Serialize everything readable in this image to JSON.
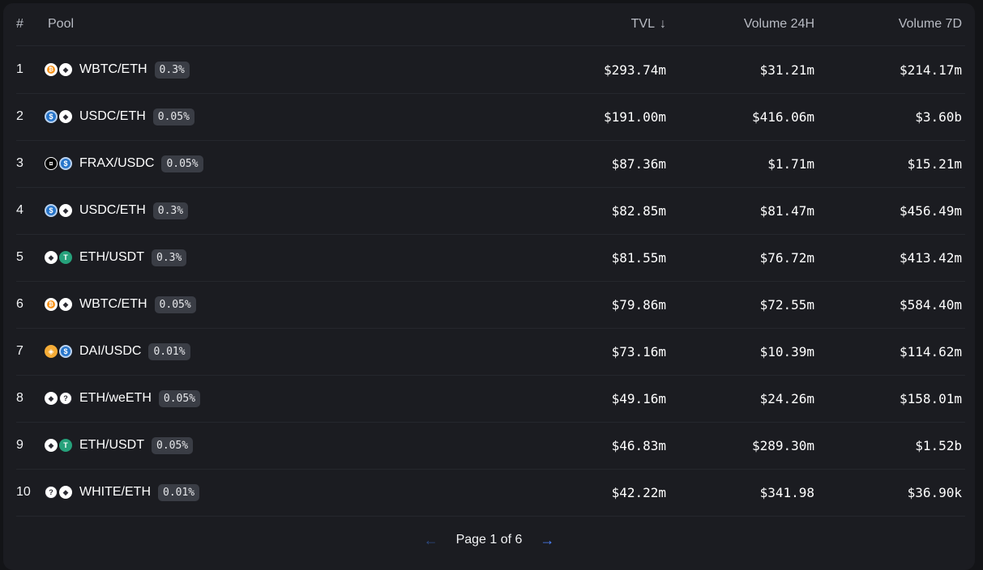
{
  "table": {
    "headers": {
      "index": "#",
      "pool": "Pool",
      "tvl": "TVL",
      "tvl_sort_icon": "arrow-down-icon",
      "volume24": "Volume 24H",
      "volume7": "Volume 7D"
    },
    "rows": [
      {
        "index": "1",
        "pair": "WBTC/ETH",
        "fee": "0.3%",
        "tvl": "$293.74m",
        "vol24": "$31.21m",
        "vol7": "$214.17m",
        "tokens": [
          "wbtc",
          "eth"
        ]
      },
      {
        "index": "2",
        "pair": "USDC/ETH",
        "fee": "0.05%",
        "tvl": "$191.00m",
        "vol24": "$416.06m",
        "vol7": "$3.60b",
        "tokens": [
          "usdc",
          "eth"
        ]
      },
      {
        "index": "3",
        "pair": "FRAX/USDC",
        "fee": "0.05%",
        "tvl": "$87.36m",
        "vol24": "$1.71m",
        "vol7": "$15.21m",
        "tokens": [
          "frax",
          "usdc"
        ]
      },
      {
        "index": "4",
        "pair": "USDC/ETH",
        "fee": "0.3%",
        "tvl": "$82.85m",
        "vol24": "$81.47m",
        "vol7": "$456.49m",
        "tokens": [
          "usdc",
          "eth"
        ]
      },
      {
        "index": "5",
        "pair": "ETH/USDT",
        "fee": "0.3%",
        "tvl": "$81.55m",
        "vol24": "$76.72m",
        "vol7": "$413.42m",
        "tokens": [
          "eth",
          "usdt"
        ]
      },
      {
        "index": "6",
        "pair": "WBTC/ETH",
        "fee": "0.05%",
        "tvl": "$79.86m",
        "vol24": "$72.55m",
        "vol7": "$584.40m",
        "tokens": [
          "wbtc",
          "eth"
        ]
      },
      {
        "index": "7",
        "pair": "DAI/USDC",
        "fee": "0.01%",
        "tvl": "$73.16m",
        "vol24": "$10.39m",
        "vol7": "$114.62m",
        "tokens": [
          "dai",
          "usdc"
        ]
      },
      {
        "index": "8",
        "pair": "ETH/weETH",
        "fee": "0.05%",
        "tvl": "$49.16m",
        "vol24": "$24.26m",
        "vol7": "$158.01m",
        "tokens": [
          "eth",
          "unknown"
        ]
      },
      {
        "index": "9",
        "pair": "ETH/USDT",
        "fee": "0.05%",
        "tvl": "$46.83m",
        "vol24": "$289.30m",
        "vol7": "$1.52b",
        "tokens": [
          "eth",
          "usdt"
        ]
      },
      {
        "index": "10",
        "pair": "WHITE/ETH",
        "fee": "0.01%",
        "tvl": "$42.22m",
        "vol24": "$341.98",
        "vol7": "$36.90k",
        "tokens": [
          "unknown",
          "eth"
        ]
      }
    ]
  },
  "pagination": {
    "label": "Page 1 of 6",
    "prev_icon": "arrow-left-icon",
    "next_icon": "arrow-right-icon"
  },
  "colors": {
    "background": "#131417",
    "panel": "#1b1c21",
    "accent": "#4c82fb",
    "badge": "#3a3d45"
  }
}
